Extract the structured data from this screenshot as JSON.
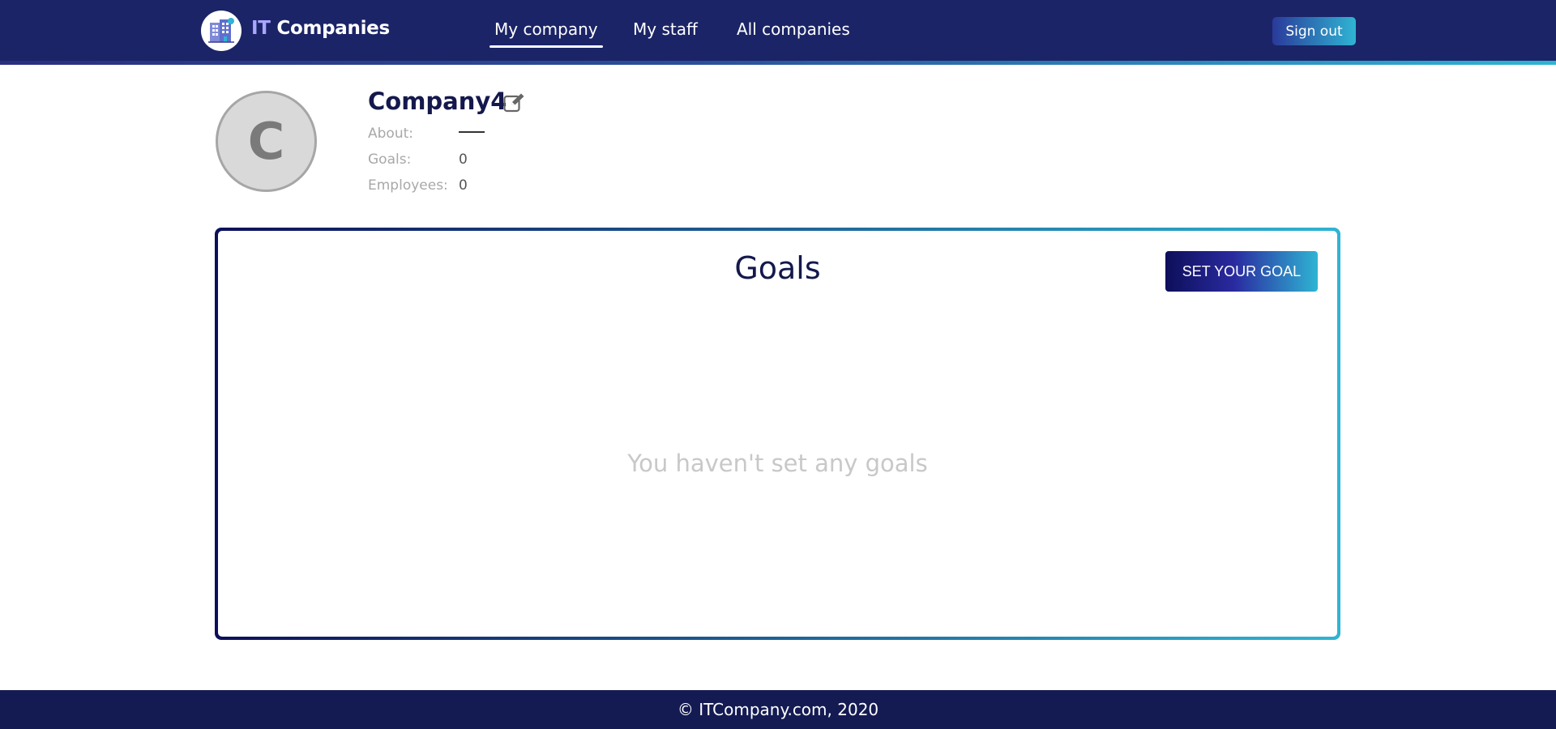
{
  "header": {
    "brand_prefix": "IT",
    "brand_suffix": " Companies",
    "nav": [
      {
        "label": "My company",
        "active": true
      },
      {
        "label": "My staff",
        "active": false
      },
      {
        "label": "All companies",
        "active": false
      }
    ],
    "signout_label": "Sign out",
    "colors": {
      "background": "#1b2466",
      "accent": "#2fb4d3",
      "brand_prefix": "#a9a6ff"
    }
  },
  "company": {
    "avatar_letter": "C",
    "name": "Company4",
    "edit_icon": "edit-icon",
    "fields": [
      {
        "label": "About:",
        "value": ""
      },
      {
        "label": "Goals:",
        "value": "0"
      },
      {
        "label": "Employees:",
        "value": "0"
      }
    ]
  },
  "goals": {
    "title": "Goals",
    "set_goal_label": "SET YOUR GOAL",
    "empty_message": "You haven't set any goals"
  },
  "footer": {
    "copyright": "© ITCompany.com, 2020"
  }
}
